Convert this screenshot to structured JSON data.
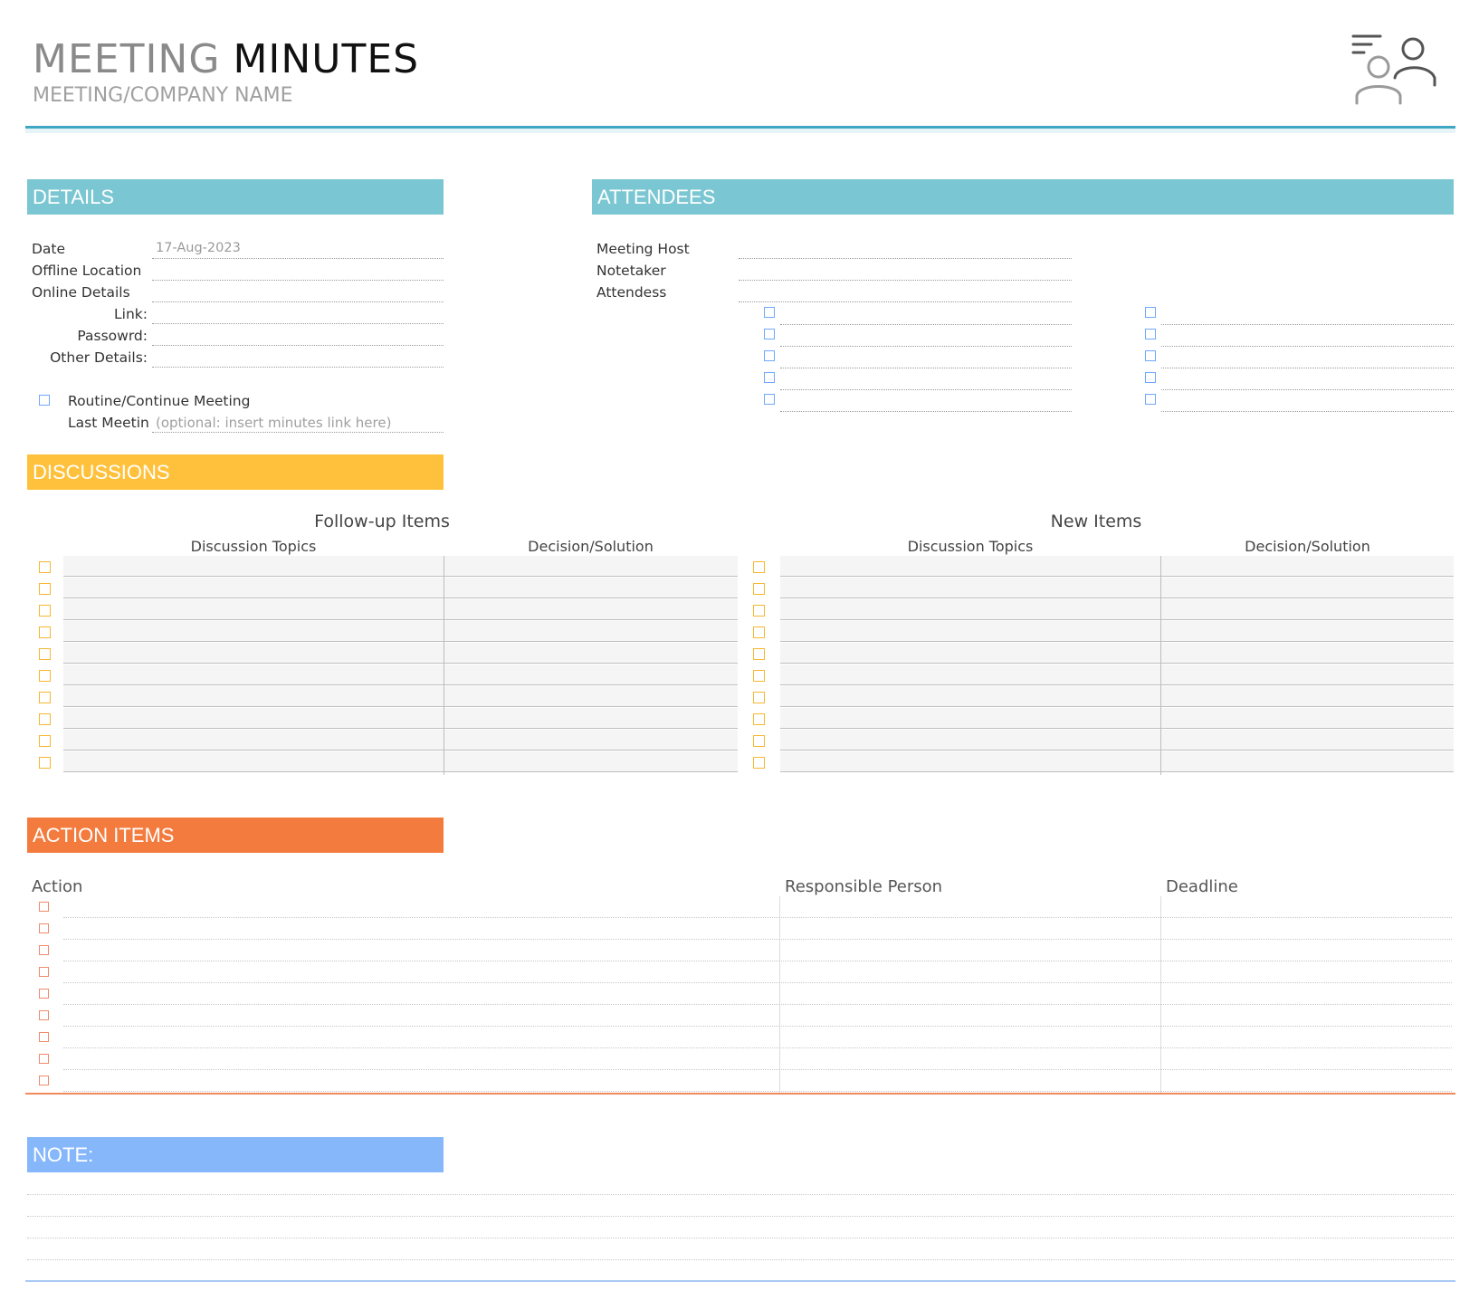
{
  "header": {
    "title_part1": "MEETING",
    "title_part2": "MINUTES",
    "subtitle": "MEETING/COMPANY NAME",
    "logo_icon": "meeting-people-icon",
    "accent": "#3fa7c2"
  },
  "details": {
    "heading": "DETAILS",
    "color": "#7ac6d2",
    "date_label": "Date",
    "date_value": "17-Aug-2023",
    "offline_label": "Offline Location",
    "online_label": "Online Details",
    "link_label": "Link:",
    "password_label": "Passowrd:",
    "other_label": "Other Details:",
    "routine_label": "Routine/Continue Meeting",
    "last_label": "Last Meetin",
    "last_placeholder": "(optional: insert minutes link here)"
  },
  "attendees": {
    "heading": "ATTENDEES",
    "color": "#7ac6d2",
    "host_label": "Meeting Host",
    "notetaker_label": "Notetaker",
    "attendess_label": "Attendess"
  },
  "discussions": {
    "heading": "DISCUSSIONS",
    "color": "#ffc13b",
    "followup_title": "Follow-up Items",
    "new_title": "New Items",
    "col_topics": "Discussion Topics",
    "col_decision": "Decision/Solution"
  },
  "action_items": {
    "heading": "ACTION ITEMS",
    "color": "#f47b3e",
    "col_action": "Action",
    "col_person": "Responsible Person",
    "col_deadline": "Deadline"
  },
  "note": {
    "heading": "NOTE:",
    "color": "#86b7fb"
  }
}
